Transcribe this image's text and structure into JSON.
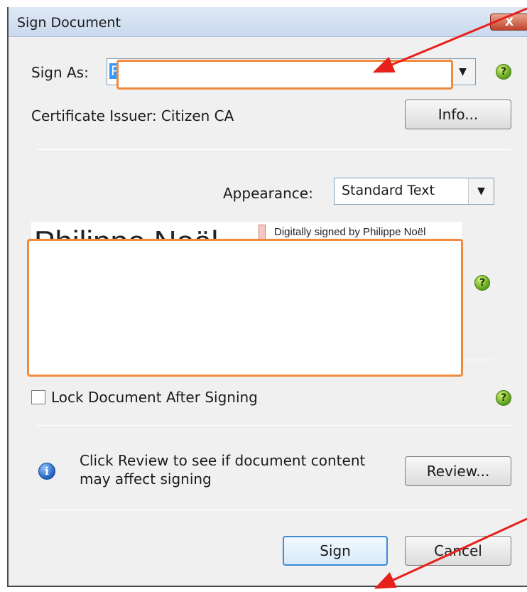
{
  "window": {
    "title": "Sign Document",
    "close_glyph": "X"
  },
  "sign_as": {
    "label": "Sign As:",
    "selected_prefix": "P"
  },
  "certificate": {
    "issuer_text": "Certificate Issuer: Citizen CA",
    "info_button": "Info..."
  },
  "appearance": {
    "label": "Appearance:",
    "selected": "Standard Text"
  },
  "preview": {
    "name": "Philippe Noël",
    "signed_text": "Digitally signed by Philippe Noël"
  },
  "lock": {
    "label": "Lock Document After Signing",
    "checked": false
  },
  "review": {
    "message_line1": "Click Review to see if document content",
    "message_line2": "may affect signing",
    "button": "Review..."
  },
  "footer": {
    "sign_button": "Sign",
    "cancel_button": "Cancel"
  },
  "icons": {
    "help": "help-icon",
    "info": "info-icon",
    "dropdown": "chevron-down-icon",
    "close": "close-icon"
  },
  "colors": {
    "highlight_box": "#f08a3c",
    "annotation_arrow": "#e8201b",
    "help_icon": "#5a9e16",
    "default_button_border": "#3c8bd6"
  }
}
